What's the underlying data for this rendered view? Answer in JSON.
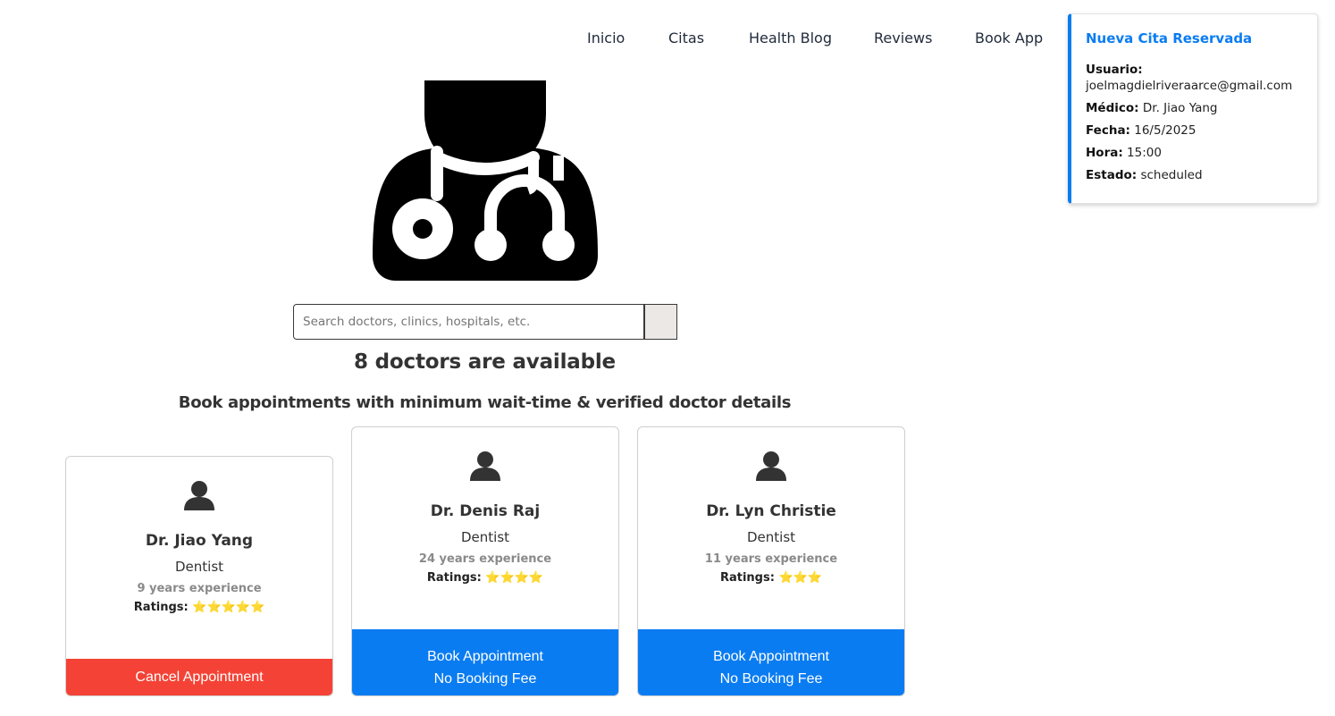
{
  "nav": {
    "items": [
      "Inicio",
      "Citas",
      "Health Blog",
      "Reviews",
      "Book App"
    ]
  },
  "notification": {
    "title": "Nueva Cita Reservada",
    "user_label": "Usuario:",
    "user_value": "joelmagdielriveraarce@gmail.com",
    "doctor_label": "Médico:",
    "doctor_value": "Dr. Jiao Yang",
    "date_label": "Fecha:",
    "date_value": "16/5/2025",
    "time_label": "Hora:",
    "time_value": "15:00",
    "status_label": "Estado:",
    "status_value": "scheduled"
  },
  "search": {
    "placeholder": "Search doctors, clinics, hospitals, etc."
  },
  "main": {
    "count_title": "8 doctors are available",
    "subtitle": "Book appointments with minimum wait-time & verified doctor details"
  },
  "doctors": [
    {
      "name": "Dr. Jiao Yang",
      "specialty": "Dentist",
      "experience": "9 years experience",
      "ratings_label": "Ratings:",
      "stars": "⭐⭐⭐⭐⭐",
      "button_line1": "Cancel Appointment",
      "button_line2": ""
    },
    {
      "name": "Dr. Denis Raj",
      "specialty": "Dentist",
      "experience": "24 years experience",
      "ratings_label": "Ratings:",
      "stars": "⭐⭐⭐⭐",
      "button_line1": "Book Appointment",
      "button_line2": "No Booking Fee"
    },
    {
      "name": "Dr. Lyn Christie",
      "specialty": "Dentist",
      "experience": "11 years experience",
      "ratings_label": "Ratings:",
      "stars": "⭐⭐⭐",
      "button_line1": "Book Appointment",
      "button_line2": "No Booking Fee"
    }
  ],
  "colors": {
    "primary": "#0a7cf2",
    "danger": "#f44336",
    "star": "#f5b800"
  }
}
